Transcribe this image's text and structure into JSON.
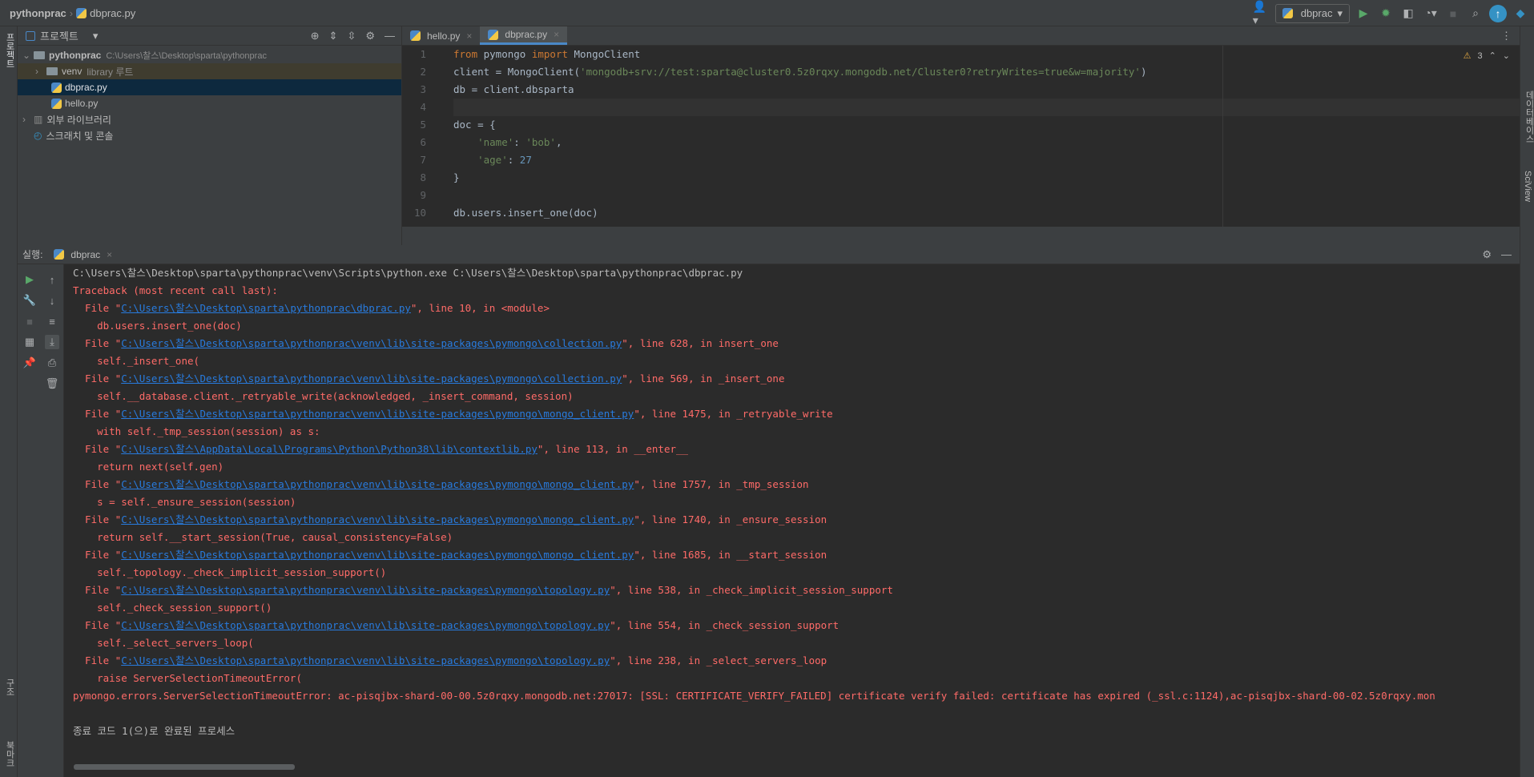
{
  "titlebar": {
    "project": "pythonprac",
    "file": "dbprac.py",
    "run_config": "dbprac"
  },
  "sidebar": {
    "project_label": "프로젝트",
    "structure_label": "구조",
    "bookmarks_label": "북마크",
    "database_label": "데이터베이스",
    "sciview_label": "SciView"
  },
  "project": {
    "header": "프로젝트",
    "root_name": "pythonprac",
    "root_path": "C:\\Users\\찰스\\Desktop\\sparta\\pythonprac",
    "venv": "venv",
    "venv_hint": "library 루트",
    "file1": "dbprac.py",
    "file2": "hello.py",
    "ext_libs": "외부 라이브러리",
    "scratches": "스크래치 및 콘솔"
  },
  "editor": {
    "tabs": [
      "hello.py",
      "dbprac.py"
    ],
    "warnings": "3",
    "line_numbers": [
      "1",
      "2",
      "3",
      "4",
      "5",
      "6",
      "7",
      "8",
      "9",
      "10"
    ]
  },
  "code": {
    "l1_kw1": "from",
    "l1_a": " pymongo ",
    "l1_kw2": "import",
    "l1_b": " MongoClient",
    "l2_a": "client = MongoClient(",
    "l2_str": "'mongodb+srv://test:sparta@cluster0.5z0rqxy.mongodb.net/Cluster0?retryWrites=true&w=majority'",
    "l2_b": ")",
    "l3": "db = client.dbsparta",
    "l5": "doc = {",
    "l6_str": "    'name'",
    "l6_a": ": ",
    "l6_val": "'bob'",
    "l6_b": ",",
    "l7_str": "    'age'",
    "l7_a": ": ",
    "l7_num": "27",
    "l8": "}",
    "l10": "db.users.insert_one(doc)"
  },
  "run": {
    "label": "실행:",
    "tab": "dbprac"
  },
  "console": {
    "cmd": "C:\\Users\\찰스\\Desktop\\sparta\\pythonprac\\venv\\Scripts\\python.exe C:\\Users\\찰스\\Desktop\\sparta\\pythonprac\\dbprac.py",
    "traceback": "Traceback (most recent call last):",
    "frames": [
      {
        "path": "C:\\Users\\찰스\\Desktop\\sparta\\pythonprac\\dbprac.py",
        "rest": "\", line 10, in <module>",
        "code": "    db.users.insert_one(doc)"
      },
      {
        "path": "C:\\Users\\찰스\\Desktop\\sparta\\pythonprac\\venv\\lib\\site-packages\\pymongo\\collection.py",
        "rest": "\", line 628, in insert_one",
        "code": "    self._insert_one("
      },
      {
        "path": "C:\\Users\\찰스\\Desktop\\sparta\\pythonprac\\venv\\lib\\site-packages\\pymongo\\collection.py",
        "rest": "\", line 569, in _insert_one",
        "code": "    self.__database.client._retryable_write(acknowledged, _insert_command, session)"
      },
      {
        "path": "C:\\Users\\찰스\\Desktop\\sparta\\pythonprac\\venv\\lib\\site-packages\\pymongo\\mongo_client.py",
        "rest": "\", line 1475, in _retryable_write",
        "code": "    with self._tmp_session(session) as s:"
      },
      {
        "path": "C:\\Users\\찰스\\AppData\\Local\\Programs\\Python\\Python38\\lib\\contextlib.py",
        "rest": "\", line 113, in __enter__",
        "code": "    return next(self.gen)"
      },
      {
        "path": "C:\\Users\\찰스\\Desktop\\sparta\\pythonprac\\venv\\lib\\site-packages\\pymongo\\mongo_client.py",
        "rest": "\", line 1757, in _tmp_session",
        "code": "    s = self._ensure_session(session)"
      },
      {
        "path": "C:\\Users\\찰스\\Desktop\\sparta\\pythonprac\\venv\\lib\\site-packages\\pymongo\\mongo_client.py",
        "rest": "\", line 1740, in _ensure_session",
        "code": "    return self.__start_session(True, causal_consistency=False)"
      },
      {
        "path": "C:\\Users\\찰스\\Desktop\\sparta\\pythonprac\\venv\\lib\\site-packages\\pymongo\\mongo_client.py",
        "rest": "\", line 1685, in __start_session",
        "code": "    self._topology._check_implicit_session_support()"
      },
      {
        "path": "C:\\Users\\찰스\\Desktop\\sparta\\pythonprac\\venv\\lib\\site-packages\\pymongo\\topology.py",
        "rest": "\", line 538, in _check_implicit_session_support",
        "code": "    self._check_session_support()"
      },
      {
        "path": "C:\\Users\\찰스\\Desktop\\sparta\\pythonprac\\venv\\lib\\site-packages\\pymongo\\topology.py",
        "rest": "\", line 554, in _check_session_support",
        "code": "    self._select_servers_loop("
      },
      {
        "path": "C:\\Users\\찰스\\Desktop\\sparta\\pythonprac\\venv\\lib\\site-packages\\pymongo\\topology.py",
        "rest": "\", line 238, in _select_servers_loop",
        "code": "    raise ServerSelectionTimeoutError("
      }
    ],
    "file_prefix": "  File \"",
    "error": "pymongo.errors.ServerSelectionTimeoutError: ac-pisqjbx-shard-00-00.5z0rqxy.mongodb.net:27017: [SSL: CERTIFICATE_VERIFY_FAILED] certificate verify failed: certificate has expired (_ssl.c:1124),ac-pisqjbx-shard-00-02.5z0rqxy.mon",
    "exit": "종료 코드 1(으)로 완료된 프로세스"
  }
}
